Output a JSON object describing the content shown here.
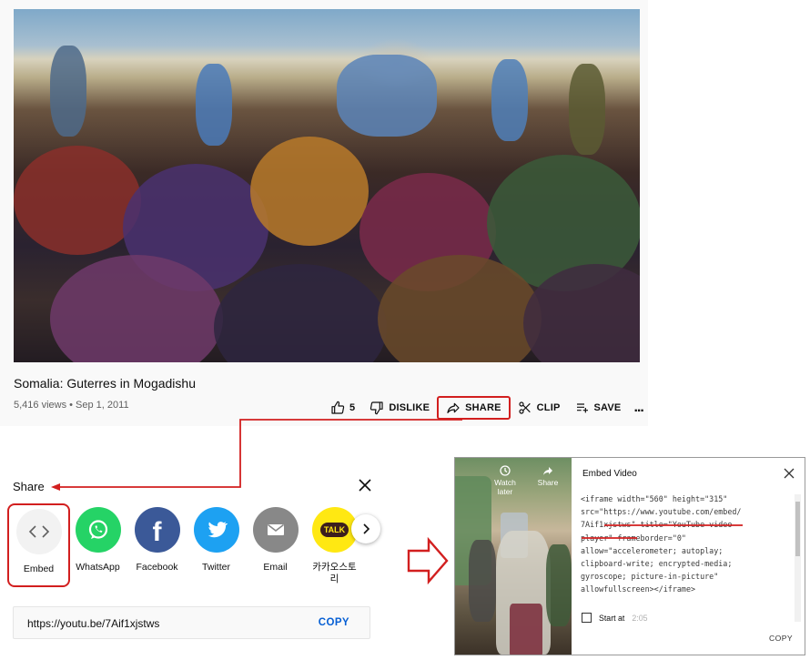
{
  "video": {
    "title": "Somalia: Guterres in Mogadishu",
    "meta": "5,416 views • Sep 1, 2011"
  },
  "actions": {
    "like_count": "5",
    "dislike": "DISLIKE",
    "share": "SHARE",
    "clip": "CLIP",
    "save": "SAVE",
    "more": "..."
  },
  "share_dialog": {
    "title": "Share",
    "items": [
      {
        "label": "Embed",
        "icon": "embed-icon",
        "color": "#f2f2f2"
      },
      {
        "label": "WhatsApp",
        "icon": "whatsapp-icon",
        "color": "#25d366"
      },
      {
        "label": "Facebook",
        "icon": "facebook-icon",
        "color": "#3b5998"
      },
      {
        "label": "Twitter",
        "icon": "twitter-icon",
        "color": "#1da1f2"
      },
      {
        "label": "Email",
        "icon": "email-icon",
        "color": "#888888"
      },
      {
        "label": "카카오스토리",
        "icon": "kakaotalk-icon",
        "color": "#ffe812"
      }
    ],
    "kakao_badge": "TALK",
    "url": "https://youtu.be/7Aif1xjstws",
    "copy": "COPY"
  },
  "embed_panel": {
    "title": "Embed Video",
    "watch_later": "Watch later",
    "share": "Share",
    "code_lines": [
      "<iframe width=\"560\" height=\"315\"",
      "src=\"https://www.youtube.com/embed/",
      "7Aif1xjstws\" title=\"YouTube video",
      "player\" frameborder=\"0\"",
      "allow=\"accelerometer; autoplay;",
      "clipboard-write; encrypted-media;",
      "gyroscope; picture-in-picture\"",
      "allowfullscreen></iframe>"
    ],
    "start_at_label": "Start at",
    "start_at_value": "2:05",
    "copy": "COPY"
  },
  "colors": {
    "highlight": "#d21f1f",
    "link_blue": "#065fd4"
  }
}
